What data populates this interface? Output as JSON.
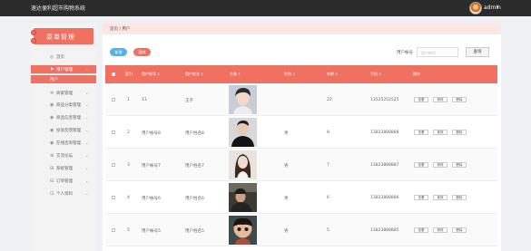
{
  "header": {
    "app_title": "速达便利超市购物系统",
    "username": "admin",
    "caret": "▾"
  },
  "sidebar": {
    "title": "菜单管理",
    "items": [
      {
        "icon": "home-icon",
        "glyph": "◎",
        "label": "首页",
        "chev": ""
      },
      {
        "icon": "user-icon",
        "glyph": "⚑",
        "label": "用户管理",
        "chev": "⌄"
      },
      {
        "icon": "",
        "glyph": "",
        "label": "用户",
        "chev": ""
      },
      {
        "icon": "goods-icon",
        "glyph": "✲",
        "label": "商家管理",
        "chev": "⌄"
      },
      {
        "icon": "category-icon",
        "glyph": "◉",
        "label": "商品分类管理",
        "chev": "⌄"
      },
      {
        "icon": "info-icon",
        "glyph": "◉",
        "label": "商品信息管理",
        "chev": "⌄"
      },
      {
        "icon": "report-icon",
        "glyph": "◉",
        "label": "投诉反馈管理",
        "chev": "⌄"
      },
      {
        "icon": "chat-icon",
        "glyph": "◉",
        "label": "在线咨询管理",
        "chev": "⌄"
      },
      {
        "icon": "forum-icon",
        "glyph": "⊕",
        "label": "交流论坛",
        "chev": "⌄"
      },
      {
        "icon": "system-icon",
        "glyph": "⊞",
        "label": "系统管理",
        "chev": "⌄"
      },
      {
        "icon": "order-icon",
        "glyph": "⊟",
        "label": "订单管理",
        "chev": "⌄"
      },
      {
        "icon": "profile-icon",
        "glyph": "⊡",
        "label": "个人资料",
        "chev": "⌄"
      }
    ]
  },
  "breadcrumb": "首页 / 用户",
  "toolbar": {
    "add_label": "新增",
    "delete_label": "删除",
    "search_label": "用户帐号",
    "search_placeholder": "用户帐号",
    "search_button": "查询"
  },
  "table": {
    "sort_glyph": "↕",
    "headers": [
      "索引",
      "用户帐号",
      "用户姓名",
      "头像",
      "性别",
      "年龄",
      "手机",
      "操作"
    ],
    "rows": [
      {
        "index": "1",
        "account": "11",
        "name": "王子",
        "gender": "",
        "age": "22",
        "phone": "13525252525",
        "photo": "photo-man-dark-hair"
      },
      {
        "index": "2",
        "account": "用户帐号8",
        "name": "用户姓名8",
        "gender": "男",
        "age": "8",
        "phone": "13823888888",
        "photo": "photo-man-black-coat"
      },
      {
        "index": "3",
        "account": "用户帐号7",
        "name": "用户姓名7",
        "gender": "男",
        "age": "7",
        "phone": "13823888887",
        "photo": "photo-woman-long-hair"
      },
      {
        "index": "4",
        "account": "用户帐号6",
        "name": "用户姓名6",
        "gender": "男",
        "age": "6",
        "phone": "13823888886",
        "photo": "photo-man-dark-scene"
      },
      {
        "index": "5",
        "account": "用户帐号5",
        "name": "用户姓名5",
        "gender": "男",
        "age": "5",
        "phone": "13823888885",
        "photo": "photo-cartoon-child"
      }
    ],
    "actions": [
      "查看",
      "修改",
      "删除"
    ]
  },
  "colors": {
    "accent": "#f07062",
    "blue": "#4fb5e8",
    "topbar": "#2b2b2b"
  }
}
